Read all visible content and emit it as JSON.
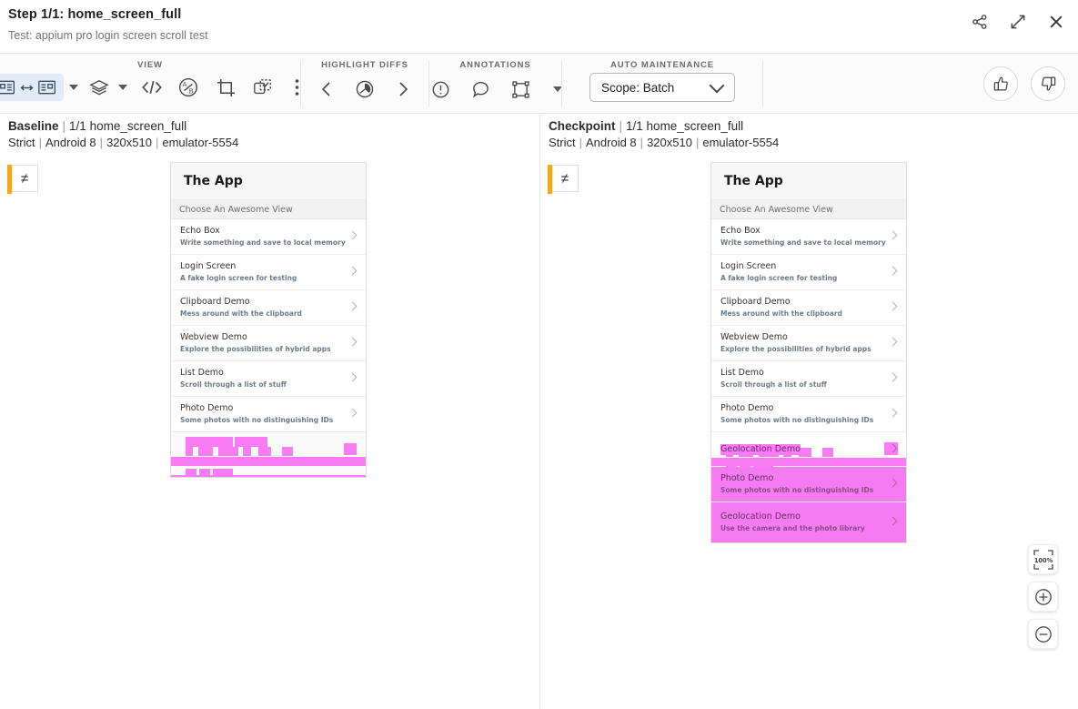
{
  "header": {
    "step_title": "Step 1/1: home_screen_full",
    "test_label": "Test: appium pro login screen scroll test",
    "actions": [
      {
        "name": "share-icon",
        "label": "Share"
      },
      {
        "name": "expand-icon",
        "label": "Expand"
      },
      {
        "name": "close-icon",
        "label": "Close"
      }
    ]
  },
  "toolbar": {
    "view": {
      "label": "VIEW",
      "buttons": [
        {
          "name": "side-by-side-icon",
          "label": "Side by side"
        },
        {
          "name": "layers-icon",
          "label": "Layers"
        },
        {
          "name": "code-icon",
          "label": "Code"
        },
        {
          "name": "ab-compare-icon",
          "label": "A/B compare"
        },
        {
          "name": "crop-icon",
          "label": "Crop"
        },
        {
          "name": "region-select-icon",
          "label": "Region select"
        },
        {
          "name": "more-options-icon",
          "label": "More"
        }
      ]
    },
    "highlight_diffs": {
      "label": "HIGHLIGHT DIFFS",
      "prev": "Previous diff",
      "target": "Highlight diffs",
      "next": "Next diff"
    },
    "annotations": {
      "label": "ANNOTATIONS",
      "issue": "Add issue",
      "comment": "Add comment",
      "region": "Add region"
    },
    "auto_maintenance": {
      "label": "AUTO MAINTENANCE",
      "scope_value": "Scope: Batch"
    },
    "thumbs_up": "Thumbs up",
    "thumbs_down": "Thumbs down"
  },
  "panes": {
    "baseline": {
      "kind": "Baseline",
      "step": "1/1 home_screen_full",
      "meta": [
        "Strict",
        "Android 8",
        "320x510",
        "emulator-5554"
      ],
      "diff_flag": "≠"
    },
    "checkpoint": {
      "kind": "Checkpoint",
      "step": "1/1 home_screen_full",
      "meta": [
        "Strict",
        "Android 8",
        "320x510",
        "emulator-5554"
      ],
      "diff_flag": "≠"
    }
  },
  "app_screenshot": {
    "app_title": "The App",
    "subheader": "Choose An Awesome View",
    "baseline_rows": [
      {
        "title": "Echo Box",
        "sub": "Write something and save to local memory",
        "highlight": false
      },
      {
        "title": "Login Screen",
        "sub": "A fake login screen for testing",
        "highlight": false
      },
      {
        "title": "Clipboard Demo",
        "sub": "Mess around with the clipboard",
        "highlight": false
      },
      {
        "title": "Webview Demo",
        "sub": "Explore the possibilities of hybrid apps",
        "highlight": false
      },
      {
        "title": "List Demo",
        "sub": "Scroll through a list of stuff",
        "highlight": false
      },
      {
        "title": "Photo Demo",
        "sub": "Some photos with no distinguishing IDs",
        "highlight": false
      }
    ],
    "checkpoint_rows": [
      {
        "title": "Echo Box",
        "sub": "Write something and save to local memory",
        "highlight": false
      },
      {
        "title": "Login Screen",
        "sub": "A fake login screen for testing",
        "highlight": false
      },
      {
        "title": "Clipboard Demo",
        "sub": "Mess around with the clipboard",
        "highlight": false
      },
      {
        "title": "Webview Demo",
        "sub": "Explore the possibilities of hybrid apps",
        "highlight": false
      },
      {
        "title": "List Demo",
        "sub": "Scroll through a list of stuff",
        "highlight": false
      },
      {
        "title": "Photo Demo",
        "sub": "Some photos with no distinguishing IDs",
        "highlight": false
      },
      {
        "title": "Geolocation Demo",
        "sub": "",
        "highlight": true
      },
      {
        "title": "Photo Demo",
        "sub": "Some photos with no distinguishing IDs",
        "highlight": true
      },
      {
        "title": "Geolocation Demo",
        "sub": "Use the camera and the photo library",
        "highlight": true
      }
    ]
  },
  "zoom_controls": {
    "fit_label": "100%",
    "zoom_in": "+",
    "zoom_out": "−"
  },
  "colors": {
    "diff_pink": "#f97cf5",
    "flag_orange": "#f5a623",
    "toggle_active_bg": "#e2ebfa",
    "toolbar_bg": "#fbfbfb"
  }
}
